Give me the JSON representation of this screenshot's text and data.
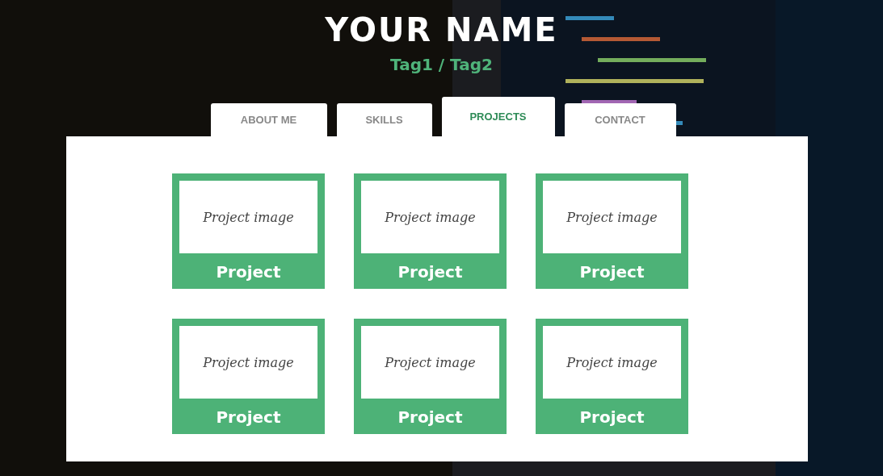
{
  "header": {
    "name": "YOUR NAME",
    "tags": "Tag1 / Tag2"
  },
  "tabs": [
    {
      "label": "ABOUT ME",
      "selected": false
    },
    {
      "label": "SKILLS",
      "selected": false
    },
    {
      "label": "PROJECTS",
      "selected": true
    },
    {
      "label": "CONTACT",
      "selected": false
    }
  ],
  "projects": [
    {
      "image_text": "Project image",
      "title": "Project"
    },
    {
      "image_text": "Project image",
      "title": "Project"
    },
    {
      "image_text": "Project image",
      "title": "Project"
    },
    {
      "image_text": "Project image",
      "title": "Project"
    },
    {
      "image_text": "Project image",
      "title": "Project"
    },
    {
      "image_text": "Project image",
      "title": "Project"
    }
  ]
}
